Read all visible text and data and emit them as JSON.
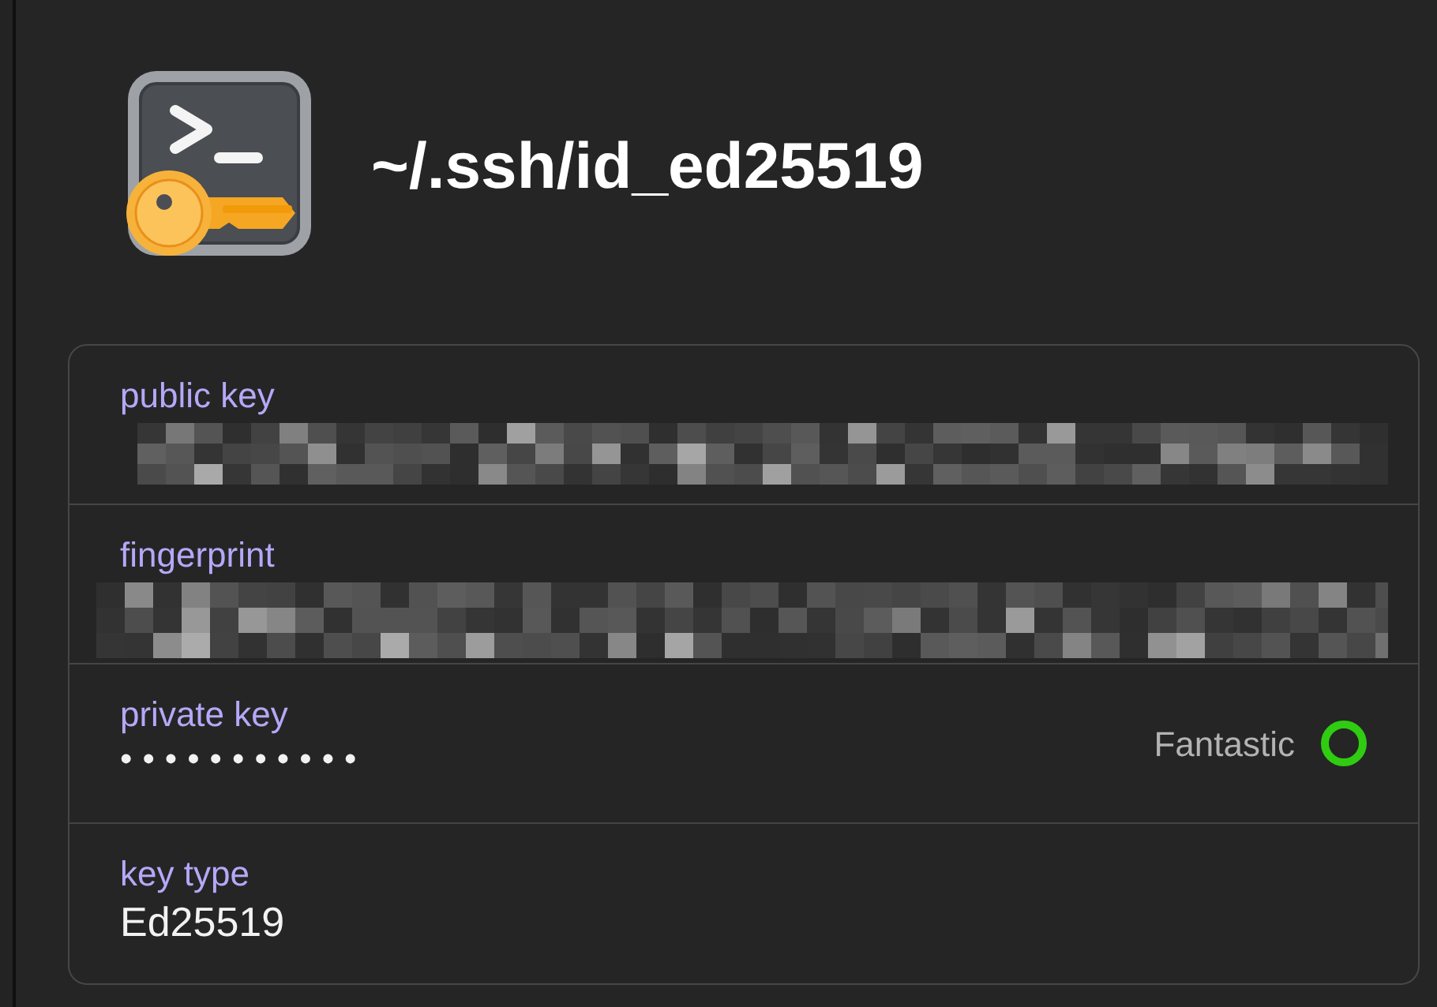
{
  "header": {
    "title": "~/.ssh/id_ed25519"
  },
  "fields": [
    {
      "label": "public key",
      "kind": "redacted"
    },
    {
      "label": "fingerprint",
      "kind": "redacted"
    },
    {
      "label": "private key",
      "kind": "secret",
      "value": "•••••••••••",
      "strength": "Fantastic"
    },
    {
      "label": "key type",
      "kind": "text",
      "value": "Ed25519"
    }
  ]
}
